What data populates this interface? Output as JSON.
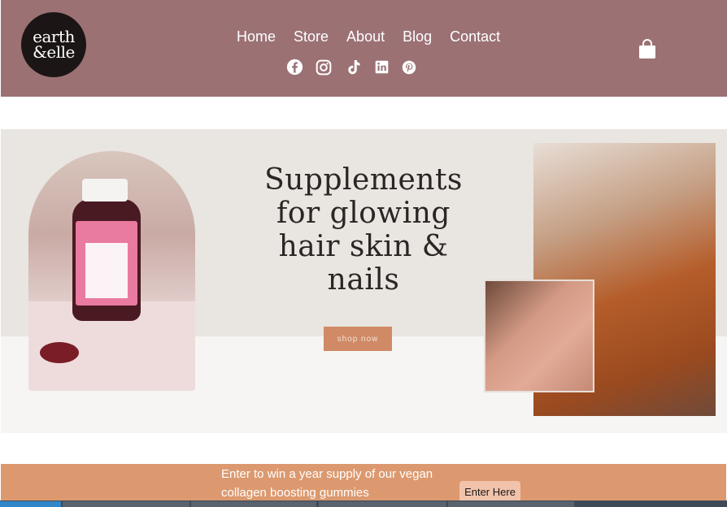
{
  "brand": {
    "logo_line1": "earth",
    "logo_line2": "&elle"
  },
  "nav": {
    "items": [
      {
        "label": "Home"
      },
      {
        "label": "Store"
      },
      {
        "label": "About"
      },
      {
        "label": "Blog"
      },
      {
        "label": "Contact"
      }
    ]
  },
  "social": {
    "icons": [
      "facebook-icon",
      "instagram-icon",
      "tiktok-icon",
      "linkedin-icon",
      "pinterest-icon"
    ]
  },
  "hero": {
    "headline_line1": "Supplements",
    "headline_line2": "for glowing",
    "headline_line3": "hair skin &",
    "headline_line4": "nails",
    "cta": "shop now"
  },
  "promo": {
    "text": "Enter to win a year supply of our vegan collagen boosting gummies",
    "button": "Enter Here"
  },
  "colors": {
    "header_bg": "#9b7174",
    "promo_bg": "#dc996f",
    "cta_bg": "#d08a66"
  }
}
